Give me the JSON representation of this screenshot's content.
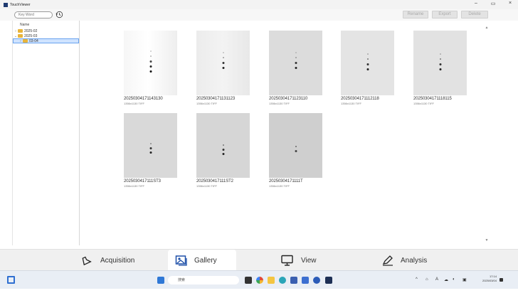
{
  "window": {
    "title": "TouchViewer",
    "minimize": "–",
    "maximize": "▭",
    "close": "×"
  },
  "toolbar": {
    "search_placeholder": "Key Word",
    "buttons": [
      "Rename",
      "Export",
      "Delete"
    ]
  },
  "tree": {
    "header": "Name",
    "items": [
      {
        "label": "2025-02",
        "expander": "›",
        "level": 0,
        "selected": false
      },
      {
        "label": "2025-03",
        "expander": "⌄",
        "level": 0,
        "selected": false
      },
      {
        "label": "03-04",
        "expander": "›",
        "level": 1,
        "selected": true
      }
    ]
  },
  "gallery": {
    "items": [
      {
        "name": "20250304171143130",
        "info": "1356x1130 TIFF"
      },
      {
        "name": "20250304171131123",
        "info": "1356x1130 TIFF"
      },
      {
        "name": "20250304171123110",
        "info": "1356x1130 TIFF"
      },
      {
        "name": "20250304171112118",
        "info": "1356x1130 TIFF"
      },
      {
        "name": "20250304171118115",
        "info": "1356x1130 TIFF"
      },
      {
        "name": "2025030417111ST3",
        "info": "1356x1130 TIFF"
      },
      {
        "name": "2025030417111ST2",
        "info": "1356x1130 TIFF"
      },
      {
        "name": "20250304171111T",
        "info": "1356x1130 TIFF"
      }
    ]
  },
  "modes": [
    {
      "label": "Acquisition",
      "icon": "flask-icon"
    },
    {
      "label": "Gallery",
      "icon": "gallery-icon"
    },
    {
      "label": "View",
      "icon": "monitor-icon"
    },
    {
      "label": "Analysis",
      "icon": "pen-icon"
    }
  ],
  "taskbar": {
    "search_text": "搜索",
    "clock_time": "17:14",
    "clock_date": "2025/03/04",
    "tray": [
      "^",
      "⌂",
      "A",
      "☁",
      "◐",
      "▣"
    ]
  }
}
